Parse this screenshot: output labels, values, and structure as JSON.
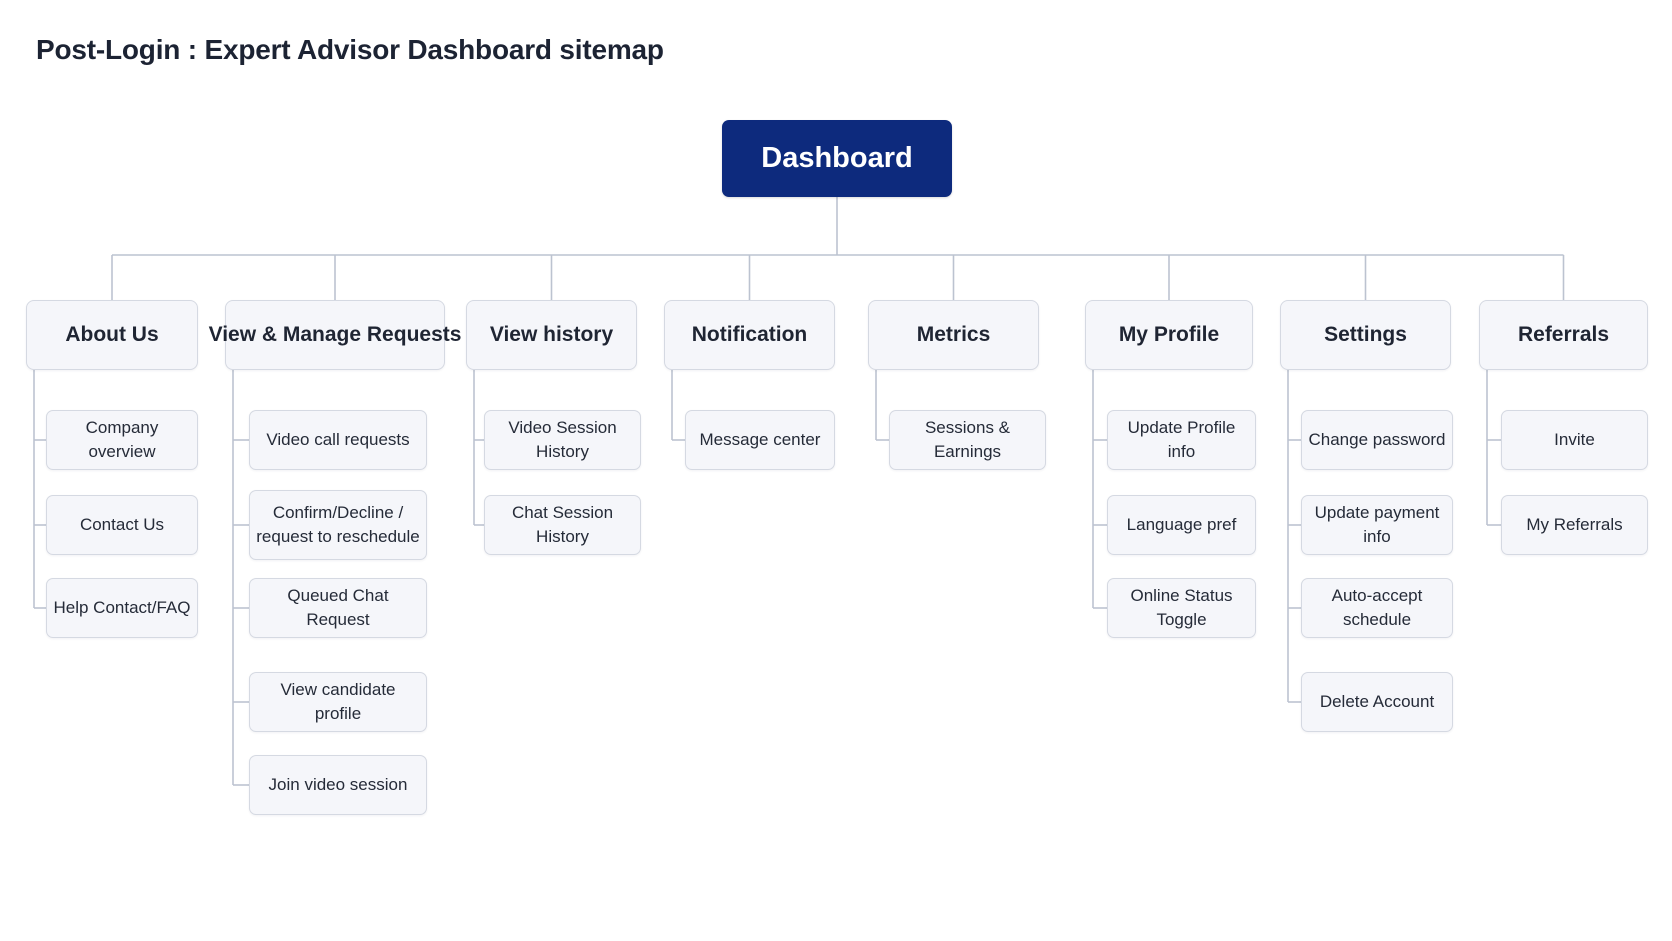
{
  "title": "Post-Login : Expert Advisor Dashboard sitemap",
  "root": {
    "label": "Dashboard"
  },
  "colors": {
    "root_fill": "#0d2a7d",
    "node_fill": "#f5f6fa",
    "node_border": "#d5d9e2",
    "connector": "#bcc3d0"
  },
  "sections": [
    {
      "label": "About Us",
      "children": [
        "Company overview",
        "Contact Us",
        "Help Contact/FAQ"
      ]
    },
    {
      "label": "View & Manage Requests",
      "children": [
        "Video call requests",
        "Confirm/Decline / request to reschedule",
        "Queued Chat Request",
        "View candidate profile",
        "Join video session"
      ]
    },
    {
      "label": "View history",
      "children": [
        "Video Session History",
        "Chat Session History"
      ]
    },
    {
      "label": "Notification",
      "children": [
        "Message center"
      ]
    },
    {
      "label": "Metrics",
      "children": [
        "Sessions & Earnings"
      ]
    },
    {
      "label": "My Profile",
      "children": [
        "Update Profile info",
        "Language pref",
        "Online Status Toggle"
      ]
    },
    {
      "label": "Settings",
      "children": [
        "Change password",
        "Update payment info",
        "Auto-accept schedule",
        "Delete Account"
      ]
    },
    {
      "label": "Referrals",
      "children": [
        "Invite",
        "My Referrals"
      ]
    }
  ]
}
